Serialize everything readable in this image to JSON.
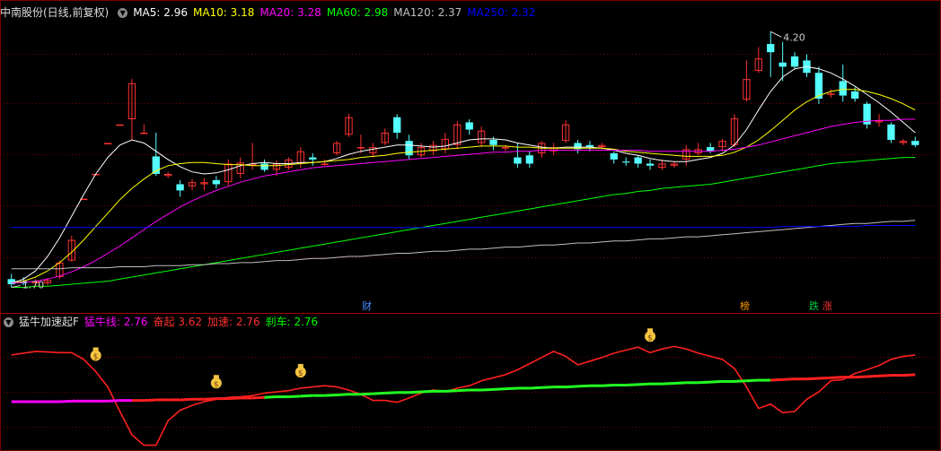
{
  "main_header": {
    "title": "中南股份(日线,前复权)",
    "ma": [
      {
        "label": "MA5: ",
        "value": "2.96",
        "color": "#ffffff"
      },
      {
        "label": "MA10: ",
        "value": "3.18",
        "color": "#ffff00"
      },
      {
        "label": "MA20: ",
        "value": "3.28",
        "color": "#ff00ff"
      },
      {
        "label": "MA60: ",
        "value": "2.98",
        "color": "#00ff00"
      },
      {
        "label": "MA120: ",
        "value": "2.37",
        "color": "#c0c0c0"
      },
      {
        "label": "MA250: ",
        "value": "2.32",
        "color": "#0000ff"
      }
    ]
  },
  "sub_header": {
    "title": "猛牛加速起F",
    "items": [
      {
        "label": "猛牛线: ",
        "value": "2.76",
        "color": "#ff00ff"
      },
      {
        "label": "奋起 ",
        "value": "3.62",
        "color": "#ff3030"
      },
      {
        "label": "加速: ",
        "value": "2.76",
        "color": "#ff3030"
      },
      {
        "label": "刹车: ",
        "value": "2.76",
        "color": "#00ff00"
      }
    ]
  },
  "events": [
    {
      "label": "财",
      "color": "#4a8cff"
    },
    {
      "label": "榜",
      "color": "#ff9900"
    },
    {
      "label": "跌",
      "color": "#00cc44"
    },
    {
      "label": "涨",
      "color": "#ff3030"
    }
  ],
  "chart_data": [
    {
      "type": "candlestick",
      "high_label": "4.20",
      "low_label": "1.70",
      "ylim": [
        1.62,
        4.35
      ],
      "candles": [
        [
          1.8,
          1.75,
          1.85,
          1.72
        ],
        [
          1.78,
          1.76,
          1.82,
          1.74
        ],
        [
          1.76,
          1.78,
          1.8,
          1.73
        ],
        [
          1.76,
          1.79,
          1.81,
          1.74
        ],
        [
          1.82,
          1.96,
          1.98,
          1.8
        ],
        [
          1.98,
          2.18,
          2.22,
          1.97
        ],
        [
          2.58,
          2.58,
          2.58,
          2.58
        ],
        [
          2.82,
          2.82,
          2.82,
          2.82
        ],
        [
          3.12,
          3.12,
          3.12,
          3.12
        ],
        [
          3.3,
          3.3,
          3.3,
          3.3
        ],
        [
          3.35,
          3.7,
          3.74,
          3.15
        ],
        [
          3.22,
          3.22,
          3.3,
          3.22
        ],
        [
          2.99,
          2.82,
          3.22,
          2.8
        ],
        [
          2.8,
          2.82,
          2.84,
          2.78
        ],
        [
          2.72,
          2.66,
          2.76,
          2.6
        ],
        [
          2.7,
          2.74,
          2.77,
          2.66
        ],
        [
          2.72,
          2.74,
          2.78,
          2.66
        ],
        [
          2.76,
          2.72,
          2.8,
          2.68
        ],
        [
          2.74,
          2.92,
          2.96,
          2.7
        ],
        [
          2.82,
          2.93,
          2.98,
          2.78
        ],
        [
          2.9,
          2.92,
          3.12,
          2.86
        ],
        [
          2.92,
          2.86,
          2.96,
          2.84
        ],
        [
          2.86,
          2.92,
          2.95,
          2.8
        ],
        [
          2.88,
          2.96,
          2.98,
          2.86
        ],
        [
          2.92,
          3.04,
          3.08,
          2.88
        ],
        [
          2.98,
          2.96,
          3.02,
          2.9
        ],
        [
          2.92,
          2.92,
          2.96,
          2.9
        ],
        [
          3.02,
          3.12,
          3.14,
          3.0
        ],
        [
          3.2,
          3.37,
          3.4,
          3.18
        ],
        [
          3.08,
          3.08,
          3.2,
          3.02
        ],
        [
          3.02,
          3.08,
          3.12,
          2.98
        ],
        [
          3.12,
          3.22,
          3.26,
          3.1
        ],
        [
          3.37,
          3.22,
          3.4,
          3.16
        ],
        [
          3.14,
          3.0,
          3.2,
          2.96
        ],
        [
          3.0,
          3.08,
          3.12,
          2.98
        ],
        [
          3.04,
          3.1,
          3.14,
          3.0
        ],
        [
          3.06,
          3.16,
          3.22,
          3.02
        ],
        [
          3.1,
          3.3,
          3.33,
          3.06
        ],
        [
          3.32,
          3.25,
          3.35,
          3.2
        ],
        [
          3.12,
          3.24,
          3.28,
          3.08
        ],
        [
          3.15,
          3.1,
          3.18,
          3.05
        ],
        [
          3.08,
          3.08,
          3.1,
          3.04
        ],
        [
          2.98,
          2.92,
          3.12,
          2.88
        ],
        [
          3.0,
          2.92,
          3.04,
          2.88
        ],
        [
          3.02,
          3.12,
          3.14,
          2.98
        ],
        [
          3.04,
          3.08,
          3.12,
          3.0
        ],
        [
          3.14,
          3.3,
          3.34,
          3.12
        ],
        [
          3.12,
          3.06,
          3.15,
          3.02
        ],
        [
          3.1,
          3.08,
          3.14,
          3.04
        ],
        [
          3.08,
          3.1,
          3.12,
          3.06
        ],
        [
          3.02,
          2.96,
          3.04,
          2.92
        ],
        [
          2.94,
          2.93,
          2.98,
          2.9
        ],
        [
          2.98,
          2.92,
          3.0,
          2.88
        ],
        [
          2.92,
          2.9,
          2.96,
          2.86
        ],
        [
          2.88,
          2.92,
          2.96,
          2.86
        ],
        [
          2.9,
          2.92,
          2.94,
          2.88
        ],
        [
          2.96,
          3.06,
          3.1,
          2.9
        ],
        [
          3.02,
          3.06,
          3.12,
          3.0
        ],
        [
          3.08,
          3.04,
          3.12,
          3.02
        ],
        [
          3.08,
          3.14,
          3.16,
          3.04
        ],
        [
          3.1,
          3.36,
          3.4,
          3.08
        ],
        [
          3.54,
          3.74,
          3.92,
          3.52
        ],
        [
          3.82,
          3.94,
          4.05,
          3.8
        ],
        [
          4.08,
          4.0,
          4.2,
          3.76
        ],
        [
          3.9,
          3.86,
          4.1,
          3.72
        ],
        [
          3.96,
          3.86,
          4.0,
          3.84
        ],
        [
          3.92,
          3.8,
          3.98,
          3.76
        ],
        [
          3.8,
          3.55,
          3.86,
          3.5
        ],
        [
          3.6,
          3.6,
          3.64,
          3.56
        ],
        [
          3.72,
          3.58,
          3.88,
          3.52
        ],
        [
          3.62,
          3.55,
          3.66,
          3.52
        ],
        [
          3.5,
          3.3,
          3.52,
          3.26
        ],
        [
          3.32,
          3.34,
          3.4,
          3.28
        ],
        [
          3.3,
          3.15,
          3.32,
          3.12
        ],
        [
          3.12,
          3.14,
          3.16,
          3.1
        ],
        [
          3.14,
          3.1,
          3.18,
          3.08
        ]
      ],
      "ma_series": [
        {
          "name": "MA5",
          "color": "#ffffff",
          "values": [
            1.76,
            1.8,
            1.88,
            2.02,
            2.2,
            2.41,
            2.62,
            2.82,
            2.98,
            3.1,
            3.15,
            3.12,
            3.04,
            2.96,
            2.89,
            2.84,
            2.82,
            2.83,
            2.86,
            2.9,
            2.92,
            2.93,
            2.92,
            2.92,
            2.93,
            2.93,
            2.94,
            2.97,
            3.01,
            3.04,
            3.06,
            3.08,
            3.1,
            3.1,
            3.09,
            3.08,
            3.09,
            3.12,
            3.15,
            3.16,
            3.16,
            3.15,
            3.12,
            3.1,
            3.08,
            3.07,
            3.08,
            3.08,
            3.08,
            3.07,
            3.05,
            3.02,
            3.0,
            2.97,
            2.95,
            2.94,
            2.94,
            2.96,
            2.98,
            3.02,
            3.1,
            3.25,
            3.44,
            3.62,
            3.76,
            3.84,
            3.86,
            3.84,
            3.8,
            3.74,
            3.67,
            3.59,
            3.51,
            3.42,
            3.32,
            3.22
          ]
        },
        {
          "name": "MA10",
          "color": "#ffff00",
          "values": [
            1.76,
            1.78,
            1.82,
            1.88,
            1.96,
            2.06,
            2.18,
            2.31,
            2.44,
            2.57,
            2.68,
            2.77,
            2.85,
            2.9,
            2.92,
            2.93,
            2.93,
            2.92,
            2.91,
            2.91,
            2.9,
            2.9,
            2.9,
            2.91,
            2.92,
            2.93,
            2.94,
            2.95,
            2.96,
            2.98,
            2.99,
            3.0,
            3.02,
            3.03,
            3.04,
            3.05,
            3.06,
            3.07,
            3.08,
            3.09,
            3.09,
            3.09,
            3.08,
            3.08,
            3.07,
            3.07,
            3.07,
            3.07,
            3.07,
            3.07,
            3.06,
            3.04,
            3.03,
            3.02,
            3.01,
            3.0,
            2.99,
            2.99,
            2.99,
            3.0,
            3.03,
            3.08,
            3.15,
            3.24,
            3.34,
            3.44,
            3.52,
            3.58,
            3.62,
            3.64,
            3.64,
            3.62,
            3.59,
            3.55,
            3.5,
            3.44
          ]
        },
        {
          "name": "MA20",
          "color": "#ff00ff",
          "values": [
            1.76,
            1.77,
            1.78,
            1.8,
            1.83,
            1.87,
            1.92,
            1.98,
            2.05,
            2.12,
            2.2,
            2.28,
            2.36,
            2.43,
            2.5,
            2.56,
            2.61,
            2.66,
            2.7,
            2.74,
            2.77,
            2.8,
            2.82,
            2.84,
            2.86,
            2.88,
            2.89,
            2.9,
            2.91,
            2.92,
            2.93,
            2.94,
            2.95,
            2.96,
            2.97,
            2.98,
            2.99,
            3.0,
            3.01,
            3.02,
            3.03,
            3.03,
            3.04,
            3.04,
            3.05,
            3.05,
            3.05,
            3.05,
            3.05,
            3.05,
            3.05,
            3.05,
            3.05,
            3.04,
            3.04,
            3.04,
            3.04,
            3.04,
            3.04,
            3.05,
            3.06,
            3.08,
            3.1,
            3.13,
            3.16,
            3.19,
            3.22,
            3.25,
            3.28,
            3.3,
            3.32,
            3.33,
            3.34,
            3.34,
            3.35,
            3.35
          ]
        },
        {
          "name": "MA60",
          "color": "#00ff00",
          "values": [
            1.72,
            1.72,
            1.73,
            1.73,
            1.74,
            1.75,
            1.76,
            1.77,
            1.78,
            1.8,
            1.82,
            1.84,
            1.86,
            1.88,
            1.9,
            1.92,
            1.94,
            1.96,
            1.98,
            2.0,
            2.02,
            2.04,
            2.06,
            2.08,
            2.1,
            2.12,
            2.14,
            2.16,
            2.18,
            2.2,
            2.22,
            2.24,
            2.26,
            2.28,
            2.3,
            2.32,
            2.34,
            2.36,
            2.38,
            2.4,
            2.42,
            2.44,
            2.46,
            2.48,
            2.5,
            2.52,
            2.54,
            2.56,
            2.58,
            2.6,
            2.62,
            2.63,
            2.65,
            2.66,
            2.68,
            2.69,
            2.7,
            2.71,
            2.72,
            2.74,
            2.76,
            2.78,
            2.8,
            2.82,
            2.84,
            2.86,
            2.88,
            2.9,
            2.92,
            2.93,
            2.94,
            2.95,
            2.96,
            2.97,
            2.98,
            2.98
          ]
        },
        {
          "name": "MA120",
          "color": "#c0c0c0",
          "values": [
            1.9,
            1.9,
            1.9,
            1.9,
            1.9,
            1.91,
            1.91,
            1.91,
            1.91,
            1.92,
            1.92,
            1.92,
            1.93,
            1.93,
            1.93,
            1.94,
            1.94,
            1.95,
            1.95,
            1.96,
            1.96,
            1.97,
            1.98,
            1.98,
            1.99,
            2.0,
            2.0,
            2.01,
            2.02,
            2.02,
            2.03,
            2.04,
            2.05,
            2.05,
            2.06,
            2.07,
            2.07,
            2.08,
            2.09,
            2.09,
            2.1,
            2.11,
            2.11,
            2.12,
            2.13,
            2.13,
            2.14,
            2.15,
            2.15,
            2.16,
            2.17,
            2.17,
            2.18,
            2.19,
            2.19,
            2.2,
            2.21,
            2.21,
            2.22,
            2.23,
            2.24,
            2.25,
            2.26,
            2.27,
            2.28,
            2.29,
            2.3,
            2.31,
            2.32,
            2.33,
            2.34,
            2.34,
            2.35,
            2.36,
            2.36,
            2.37
          ]
        },
        {
          "name": "MA250",
          "color": "#0000ff",
          "values": [
            2.3,
            2.3,
            2.3,
            2.3,
            2.3,
            2.3,
            2.3,
            2.3,
            2.3,
            2.3,
            2.3,
            2.3,
            2.3,
            2.3,
            2.3,
            2.3,
            2.3,
            2.3,
            2.3,
            2.3,
            2.3,
            2.3,
            2.3,
            2.3,
            2.3,
            2.3,
            2.3,
            2.3,
            2.3,
            2.3,
            2.3,
            2.3,
            2.3,
            2.3,
            2.3,
            2.3,
            2.3,
            2.3,
            2.3,
            2.3,
            2.3,
            2.3,
            2.3,
            2.3,
            2.3,
            2.3,
            2.3,
            2.3,
            2.3,
            2.3,
            2.3,
            2.3,
            2.3,
            2.3,
            2.3,
            2.3,
            2.3,
            2.3,
            2.3,
            2.3,
            2.3,
            2.3,
            2.3,
            2.3,
            2.31,
            2.31,
            2.31,
            2.31,
            2.31,
            2.31,
            2.31,
            2.32,
            2.32,
            2.32,
            2.32,
            2.32
          ]
        }
      ]
    },
    {
      "type": "line",
      "ylim": [
        2.0,
        3.9
      ],
      "speed": [
        3.52,
        3.55,
        3.58,
        3.57,
        3.56,
        3.56,
        3.45,
        3.25,
        3.0,
        2.6,
        2.22,
        2.05,
        2.05,
        2.45,
        2.62,
        2.7,
        2.76,
        2.8,
        2.83,
        2.84,
        2.86,
        2.9,
        2.92,
        2.94,
        2.98,
        3.0,
        3.02,
        3.0,
        2.95,
        2.88,
        2.78,
        2.78,
        2.75,
        2.82,
        2.9,
        2.95,
        2.92,
        2.98,
        3.02,
        3.1,
        3.15,
        3.2,
        3.28,
        3.38,
        3.48,
        3.58,
        3.5,
        3.36,
        3.42,
        3.48,
        3.55,
        3.6,
        3.65,
        3.56,
        3.62,
        3.66,
        3.62,
        3.55,
        3.5,
        3.45,
        3.3,
        3.0,
        2.65,
        2.72,
        2.58,
        2.6,
        2.8,
        2.92,
        3.1,
        3.12,
        3.22,
        3.28,
        3.35,
        3.45,
        3.5,
        3.52
      ],
      "baseline": [
        2.76,
        2.76,
        2.76,
        2.76,
        2.76,
        2.77,
        2.77,
        2.77,
        2.77,
        2.78,
        2.78,
        2.78,
        2.79,
        2.79,
        2.79,
        2.8,
        2.8,
        2.81,
        2.81,
        2.82,
        2.82,
        2.83,
        2.84,
        2.84,
        2.85,
        2.86,
        2.86,
        2.87,
        2.88,
        2.88,
        2.89,
        2.9,
        2.91,
        2.91,
        2.92,
        2.93,
        2.93,
        2.94,
        2.95,
        2.95,
        2.96,
        2.97,
        2.98,
        2.98,
        2.99,
        3.0,
        3.0,
        3.01,
        3.02,
        3.02,
        3.03,
        3.03,
        3.04,
        3.05,
        3.05,
        3.06,
        3.07,
        3.07,
        3.08,
        3.09,
        3.09,
        3.1,
        3.11,
        3.11,
        3.12,
        3.13,
        3.13,
        3.14,
        3.15,
        3.16,
        3.16,
        3.17,
        3.18,
        3.19,
        3.19,
        3.2
      ],
      "baseline_state": "mmmmmmmmmmrrrrrrrrrrrggggggggggggggggggggggggggggggggggggggggggrrrrrrrrrrrrrrrrrrrrgggggggg",
      "signals": [
        7,
        17,
        24,
        53
      ]
    }
  ]
}
